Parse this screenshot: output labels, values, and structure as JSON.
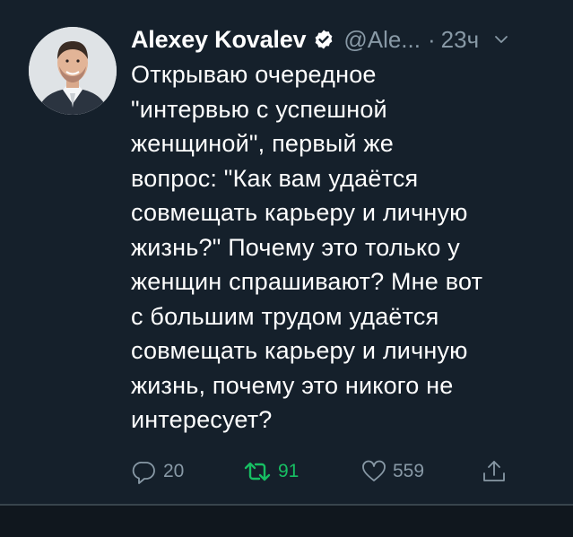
{
  "tweet": {
    "author_name": "Alexey Kovalev",
    "handle": "@Ale...",
    "separator_dot": "·",
    "time": "23ч",
    "verified": true,
    "text": "Открываю очередное\n\"интервью с успешной\nженщиной\", первый же\nвопрос: \"Как вам удаётся\nсовмещать карьеру и личную\nжизнь?\" Почему это только у\nженщин спрашивают? Мне вот\nс большим трудом удаётся\nсовмещать карьеру и личную\nжизнь, почему это никого не\nинтересует?",
    "actions": {
      "reply_count": "20",
      "retweet_count": "91",
      "like_count": "559"
    }
  },
  "icons": {
    "verified": "verified-badge-icon",
    "caret": "chevron-down-icon",
    "reply": "reply-icon",
    "retweet": "retweet-icon",
    "like": "heart-icon",
    "share": "share-icon"
  },
  "colors": {
    "background": "#15202b",
    "secondary_text": "#8899a6",
    "retweet_active": "#17bf63",
    "divider": "#38444d"
  }
}
